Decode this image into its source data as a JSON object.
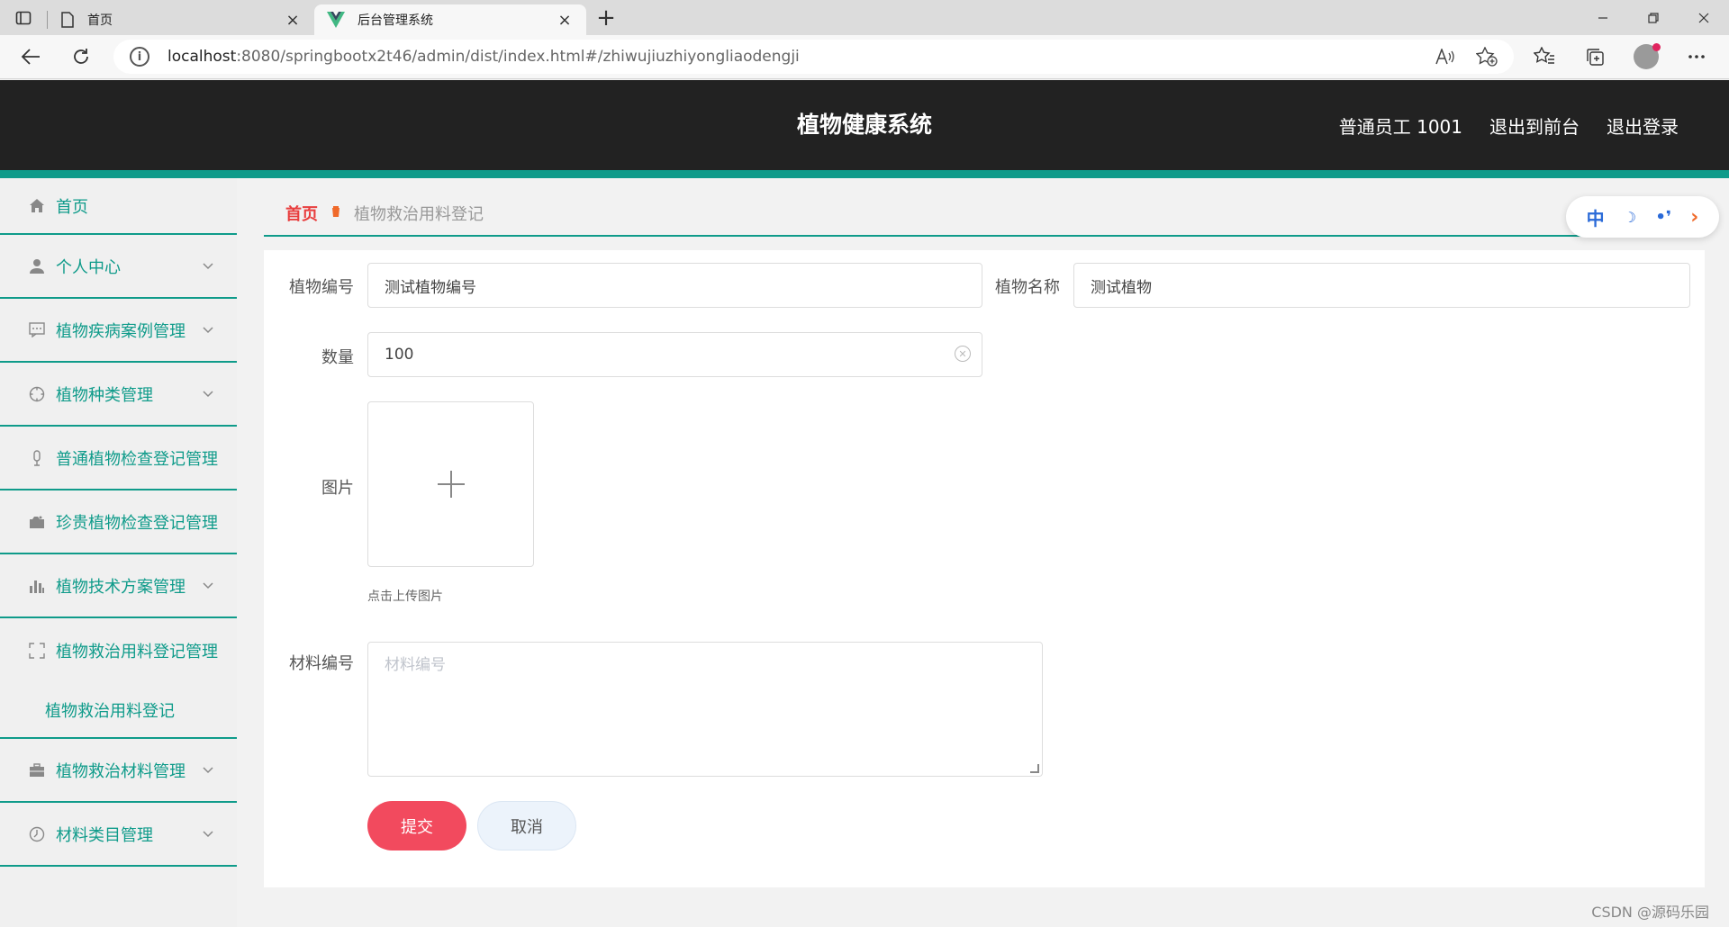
{
  "browser": {
    "tabs": [
      {
        "title": "首页",
        "active": false
      },
      {
        "title": "后台管理系统",
        "active": true
      }
    ],
    "url_host": "localhost",
    "url_path": ":8080/springbootx2t46/admin/dist/index.html#/zhiwujiuzhiyongliaodengji",
    "new_tab_glyph": "+",
    "close_glyph": "×"
  },
  "header": {
    "title": "植物健康系统",
    "user": "普通员工 1001",
    "to_front": "退出到前台",
    "logout": "退出登录"
  },
  "sidebar": {
    "items": [
      {
        "label": "首页",
        "icon": "home-icon",
        "expandable": false
      },
      {
        "label": "个人中心",
        "icon": "user-icon",
        "expandable": true
      },
      {
        "label": "植物疾病案例管理",
        "icon": "message-icon",
        "expandable": true
      },
      {
        "label": "植物种类管理",
        "icon": "compass-icon",
        "expandable": true
      },
      {
        "label": "普通植物检查登记管理",
        "icon": "microphone-icon",
        "expandable": false
      },
      {
        "label": "珍贵植物检查登记管理",
        "icon": "camera-icon",
        "expandable": false
      },
      {
        "label": "植物技术方案管理",
        "icon": "bar-chart-icon",
        "expandable": true
      },
      {
        "label": "植物救治用料登记管理",
        "icon": "fullscreen-icon",
        "expandable": false
      },
      {
        "label": "植物救治材料管理",
        "icon": "suitcase-icon",
        "expandable": true
      },
      {
        "label": "材料类目管理",
        "icon": "clock-icon",
        "expandable": true
      }
    ],
    "submenu_label": "植物救治用料登记"
  },
  "breadcrumb": {
    "home": "首页",
    "current": "植物救治用料登记"
  },
  "tool_widget": {
    "lang": "中",
    "moon": "☽",
    "quote": "•❜",
    "arrow": "›"
  },
  "form": {
    "plant_no_label": "植物编号",
    "plant_no_value": "测试植物编号",
    "plant_name_label": "植物名称",
    "plant_name_value": "测试植物",
    "quantity_label": "数量",
    "quantity_value": "100",
    "image_label": "图片",
    "upload_tip": "点击上传图片",
    "material_no_label": "材料编号",
    "material_no_placeholder": "材料编号",
    "submit_label": "提交",
    "cancel_label": "取消"
  },
  "watermark": "CSDN @源码乐园",
  "colors": {
    "accent": "#0f9b8a",
    "header_bg": "#222222",
    "submit": "#f24a5e",
    "breadcrumb_home": "#e83e3e"
  }
}
